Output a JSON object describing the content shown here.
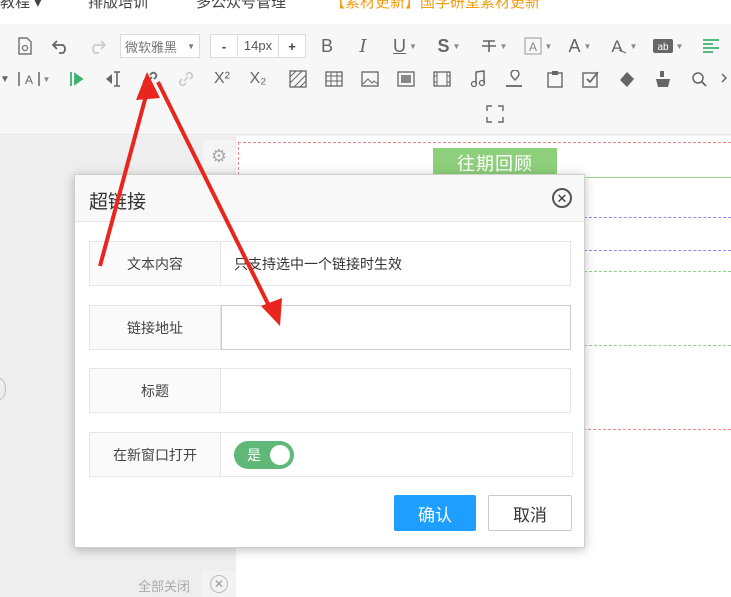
{
  "top_nav": {
    "item1": "教程 ▾",
    "item2": "排版培训",
    "item3": "多公众号管理",
    "notice": "【素材更新】国学研堂素材更新"
  },
  "toolbar": {
    "font_family": "微软雅黑",
    "font_size": "14px",
    "size_minus": "-",
    "size_plus": "+",
    "bold": "B",
    "italic": "I",
    "underline": "U",
    "strike": "S",
    "font_color": "A",
    "superscript": "X²",
    "subscript": "X₂"
  },
  "canvas": {
    "past_button": "往期回顾",
    "close_all": "全部关闭"
  },
  "dialog": {
    "title": "超链接",
    "rows": [
      {
        "label": "文本内容",
        "value": "只支持选中一个链接时生效"
      },
      {
        "label": "链接地址",
        "value": ""
      },
      {
        "label": "标题",
        "value": ""
      },
      {
        "label": "在新窗口打开",
        "toggle": "是"
      }
    ],
    "confirm": "确认",
    "cancel": "取消"
  },
  "colors": {
    "accent_blue": "#1e9fff",
    "toggle_green": "#5fb878",
    "annotation_red": "#e8261e",
    "past_button_green": "#8dcf7a"
  }
}
